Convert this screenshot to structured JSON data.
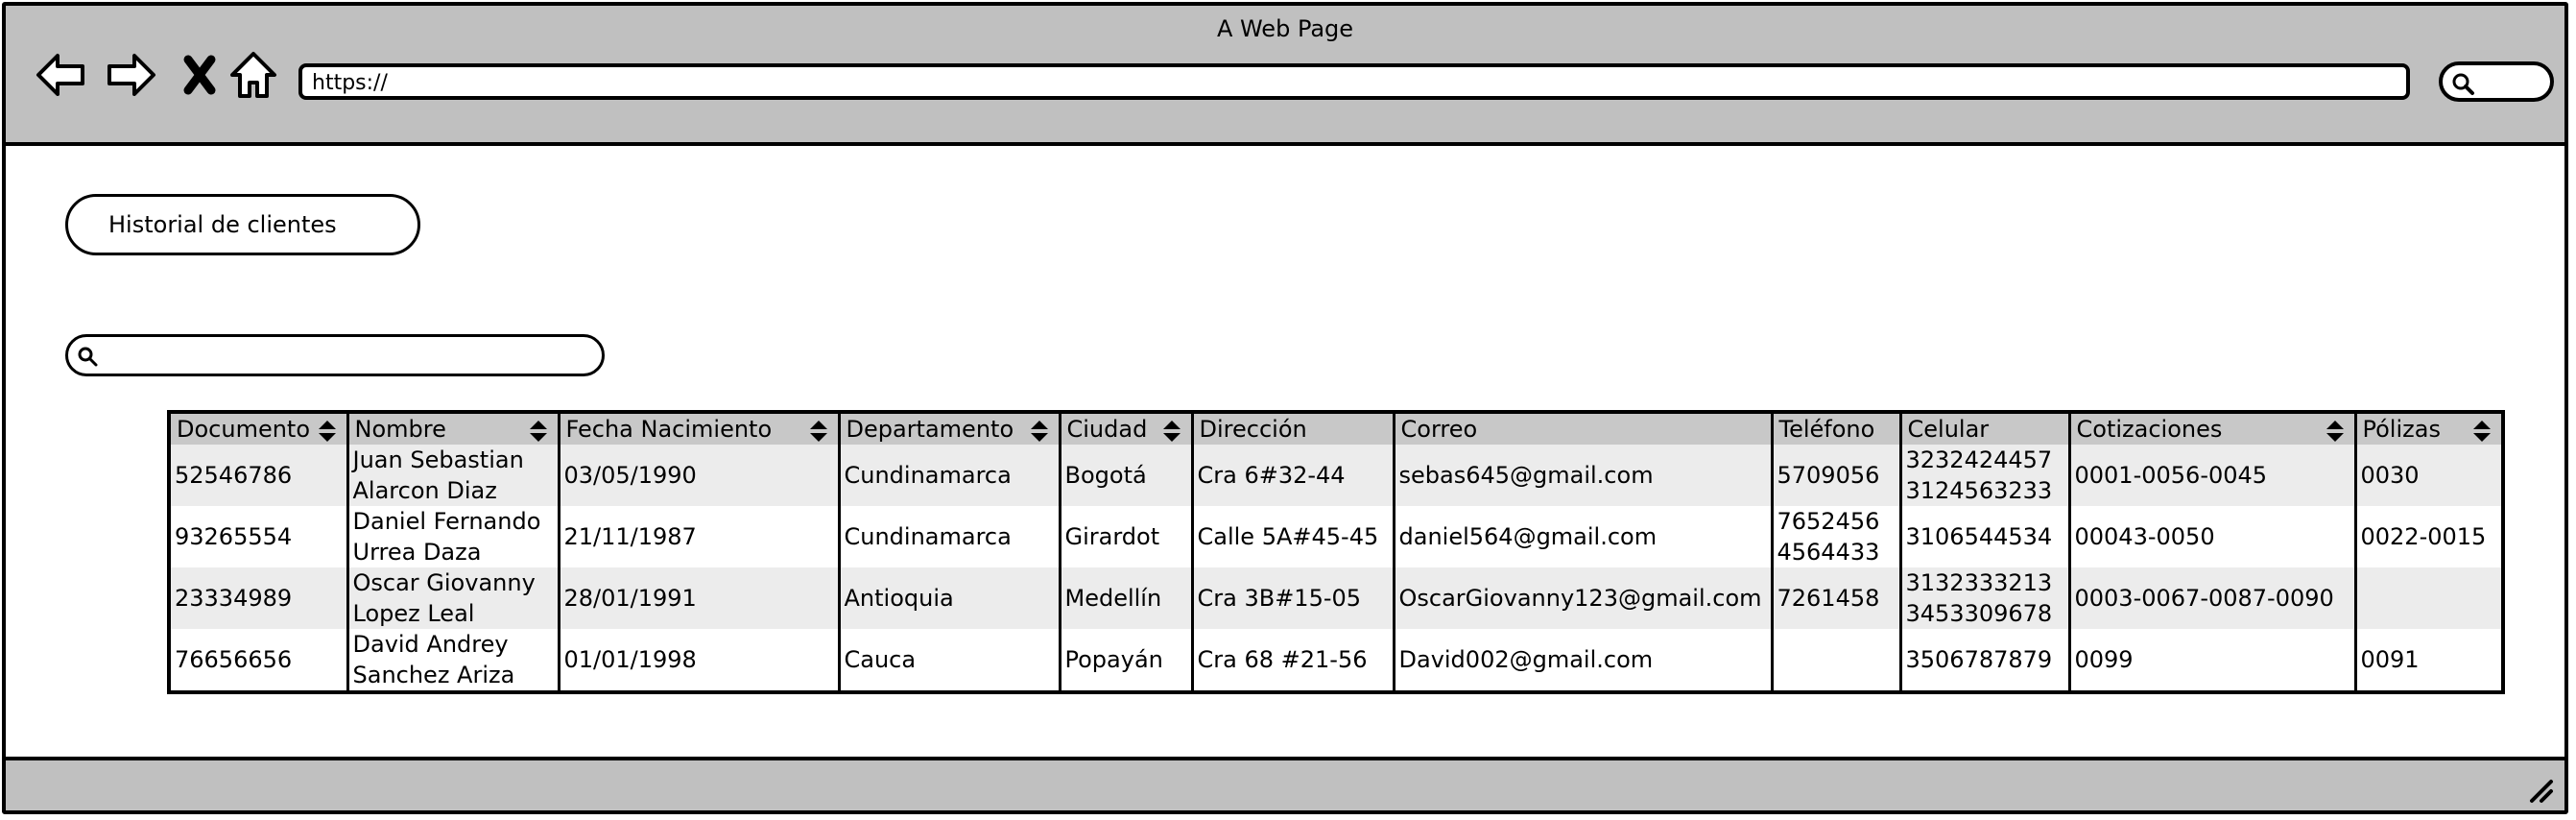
{
  "browser": {
    "title": "A Web Page",
    "url": "https://"
  },
  "page": {
    "history_button": "Historial de clientes",
    "search_placeholder": ""
  },
  "table": {
    "columns": [
      "Documento",
      "Nombre",
      "Fecha Nacimiento",
      "Departamento",
      "Ciudad",
      "Dirección",
      "Correo",
      "Teléfono",
      "Celular",
      "Cotizaciones",
      "Pólizas"
    ],
    "sortable": [
      true,
      true,
      true,
      true,
      true,
      false,
      false,
      false,
      false,
      true,
      true
    ],
    "rows": [
      {
        "documento": "52546786",
        "nombre": [
          "Juan Sebastian",
          "Alarcon Diaz"
        ],
        "fecha": "03/05/1990",
        "departamento": "Cundinamarca",
        "ciudad": "Bogotá",
        "direccion": "Cra 6#32-44",
        "correo": "sebas645@gmail.com",
        "telefono": [
          "5709056"
        ],
        "celular": [
          "3232424457",
          "3124563233"
        ],
        "cotizaciones": "0001-0056-0045",
        "polizas": "0030"
      },
      {
        "documento": "93265554",
        "nombre": [
          "Daniel Fernando",
          "Urrea Daza"
        ],
        "fecha": "21/11/1987",
        "departamento": "Cundinamarca",
        "ciudad": "Girardot",
        "direccion": "Calle 5A#45-45",
        "correo": "daniel564@gmail.com",
        "telefono": [
          "7652456",
          "4564433"
        ],
        "celular": [
          "3106544534"
        ],
        "cotizaciones": "00043-0050",
        "polizas": "0022-0015"
      },
      {
        "documento": "23334989",
        "nombre": [
          "Oscar Giovanny",
          "Lopez Leal"
        ],
        "fecha": "28/01/1991",
        "departamento": "Antioquia",
        "ciudad": "Medellín",
        "direccion": "Cra 3B#15-05",
        "correo": "OscarGiovanny123@gmail.com",
        "telefono": [
          "7261458"
        ],
        "celular": [
          "3132333213",
          "3453309678"
        ],
        "cotizaciones": "0003-0067-0087-0090",
        "polizas": ""
      },
      {
        "documento": "76656656",
        "nombre": [
          "David Andrey",
          "Sanchez Ariza"
        ],
        "fecha": "01/01/1998",
        "departamento": "Cauca",
        "ciudad": "Popayán",
        "direccion": "Cra 68 #21-56",
        "correo": "David002@gmail.com",
        "telefono": [],
        "celular": [
          "3506787879"
        ],
        "cotizaciones": "0099",
        "polizas": "0091"
      }
    ]
  },
  "colors": {
    "chrome": "#c0c0c0",
    "header": "#c8c8c8",
    "row_alt": "#ececec"
  }
}
